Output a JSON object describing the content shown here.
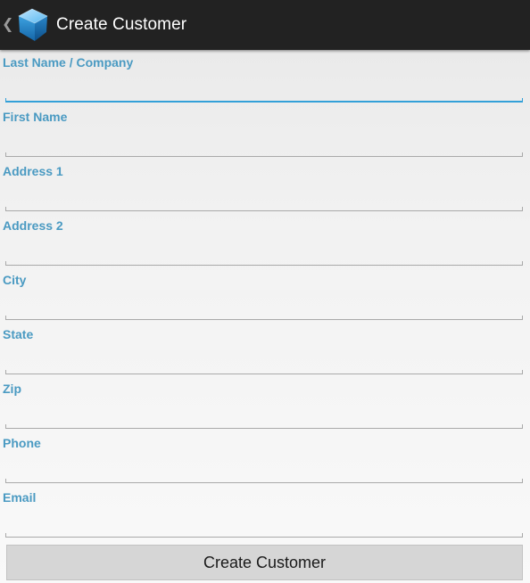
{
  "action_bar": {
    "title": "Create Customer",
    "back_icon": "chevron-left-icon",
    "app_icon": "cube-icon"
  },
  "form": {
    "fields": [
      {
        "label": "Last Name / Company",
        "value": "",
        "focused": true
      },
      {
        "label": "First Name",
        "value": ""
      },
      {
        "label": "Address 1",
        "value": ""
      },
      {
        "label": "Address 2",
        "value": ""
      },
      {
        "label": "City",
        "value": ""
      },
      {
        "label": "State",
        "value": ""
      },
      {
        "label": "Zip",
        "value": ""
      },
      {
        "label": "Phone",
        "value": ""
      },
      {
        "label": "Email",
        "value": ""
      }
    ],
    "submit_label": "Create Customer"
  },
  "colors": {
    "action_bar_bg": "#222222",
    "label": "#4a9ac2",
    "focus_accent": "#33a0d8",
    "button_bg": "#d6d6d6"
  }
}
